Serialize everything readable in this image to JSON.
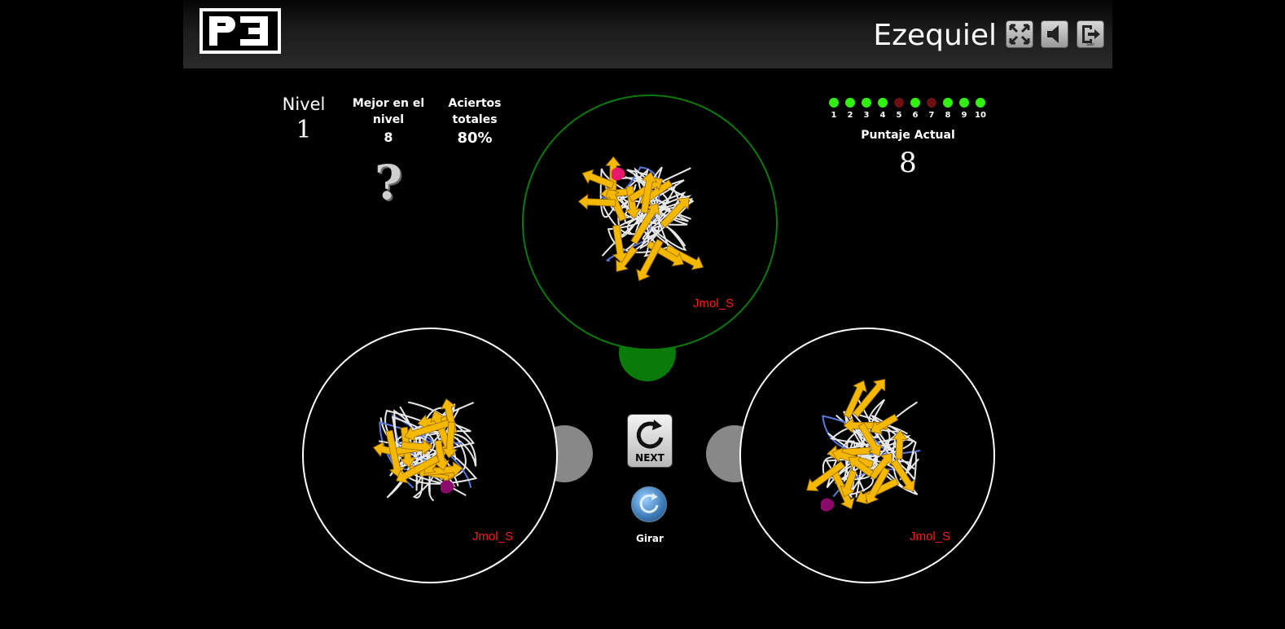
{
  "header": {
    "logo_text": "P3",
    "username": "Ezequiel",
    "buttons": [
      {
        "name": "fullscreen-button",
        "icon": "fullscreen-icon"
      },
      {
        "name": "sound-button",
        "icon": "speaker-icon"
      },
      {
        "name": "exit-button",
        "icon": "exit-icon",
        "label": "Salir"
      }
    ]
  },
  "stats": {
    "nivel": {
      "label": "Nivel",
      "value": "1"
    },
    "mejor": {
      "label_line1": "Mejor en el",
      "label_line2": "nivel",
      "value": "8"
    },
    "aciertos": {
      "label_line1": "Aciertos",
      "label_line2": "totales",
      "value": "80%"
    },
    "unknown_mark": "?"
  },
  "progress": {
    "numbers": [
      "1",
      "2",
      "3",
      "4",
      "5",
      "6",
      "7",
      "8",
      "9",
      "10"
    ],
    "results": [
      "correct",
      "correct",
      "correct",
      "correct",
      "wrong",
      "correct",
      "wrong",
      "correct",
      "correct",
      "correct"
    ],
    "colors": {
      "correct": "#33ee11",
      "wrong": "#6b1111"
    }
  },
  "score": {
    "label": "Puntaje Actual",
    "value": "8"
  },
  "viewers": {
    "target": {
      "label": "Jmol_S",
      "border_color": "#0b7a0b"
    },
    "left": {
      "label": "Jmol_S",
      "border_color": "#ffffff"
    },
    "right": {
      "label": "Jmol_S",
      "border_color": "#ffffff"
    }
  },
  "controls": {
    "next_label": "NEXT",
    "rotate_label": "Girar"
  },
  "colors": {
    "strand": "#f5b800",
    "coil": "#e8e8e8",
    "turn": "#5a78d8",
    "helix_pink": "#e8186e",
    "helix_purple": "#8a0a6a",
    "target_knob": "#0a7a0a",
    "option_knob": "#888888"
  }
}
